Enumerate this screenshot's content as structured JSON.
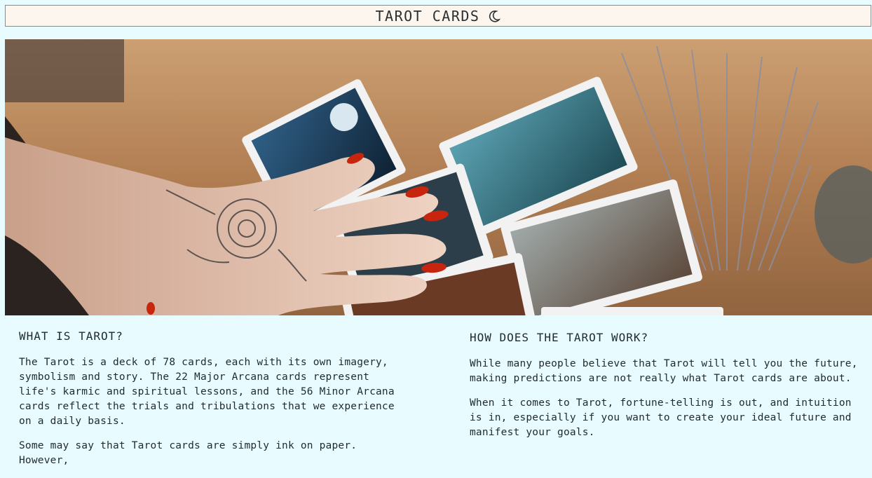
{
  "header": {
    "title": "TAROT CARDS",
    "icon": "moon-icon"
  },
  "hero": {
    "alt": "Hand with red nails resting on tarot cards spread on a wooden table with dried lavender"
  },
  "sections": {
    "left": {
      "heading": "WHAT IS TAROT?",
      "p1": "The Tarot is a deck of 78 cards, each with its own imagery, symbolism and story. The 22 Major Arcana cards represent life's karmic and spiritual lessons, and the 56 Minor Arcana cards reflect the trials and tribulations that we experience on a daily basis.",
      "p2": "Some may say that Tarot cards are simply ink on paper. However,"
    },
    "right": {
      "heading": "HOW DOES THE TAROT WORK?",
      "p1": "While many people believe that Tarot will tell you the future, making predictions are not really what Tarot cards are about.",
      "p2": "When it comes to Tarot, fortune-telling is out, and intuition is in, especially if you want to create your ideal future and manifest your goals."
    }
  }
}
